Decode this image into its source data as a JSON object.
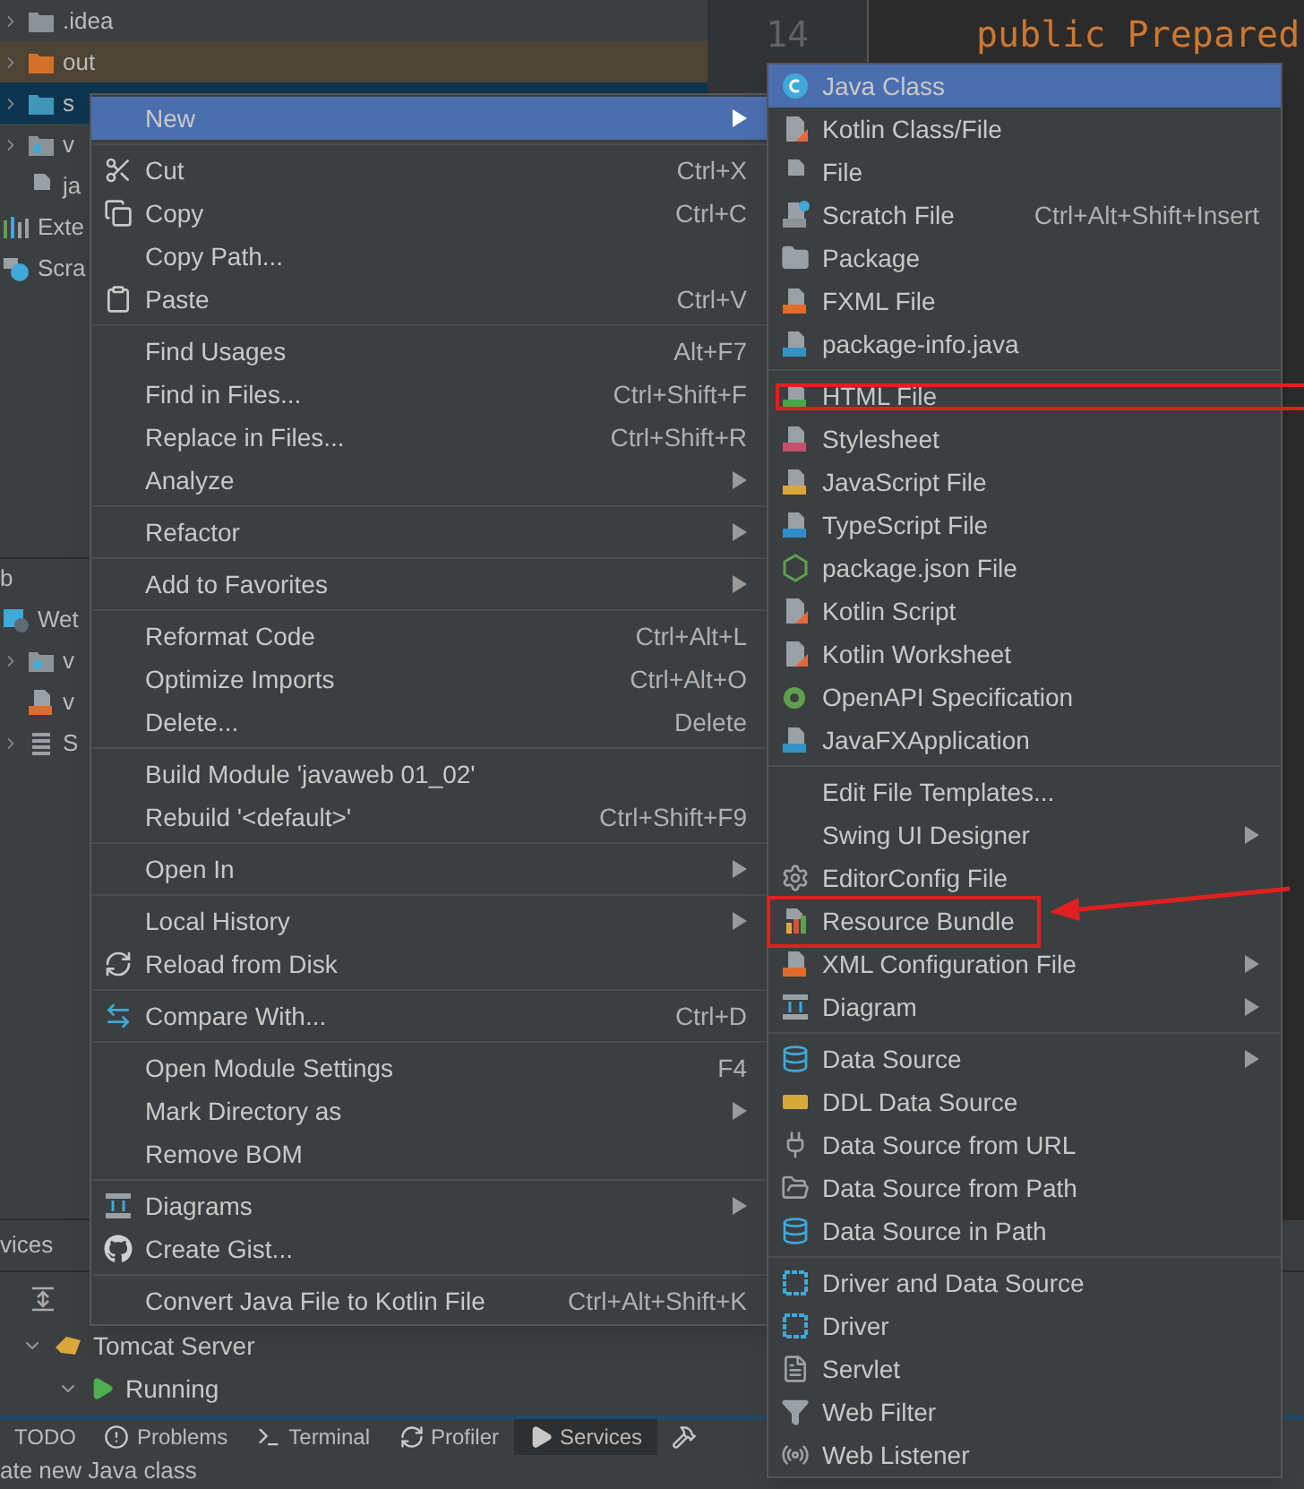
{
  "project_tree": [
    {
      "label": ".idea",
      "kind": "folder_gray",
      "selected": false,
      "highlighted": false,
      "expandable": true
    },
    {
      "label": "out",
      "kind": "folder_orange",
      "selected": false,
      "highlighted": true,
      "expandable": true
    },
    {
      "label": "s",
      "kind": "folder_blue",
      "selected": true,
      "highlighted": false,
      "expandable": true
    },
    {
      "label": "v",
      "kind": "folder_web",
      "selected": false,
      "highlighted": false,
      "expandable": true
    },
    {
      "label": "ja",
      "kind": "file",
      "selected": false,
      "highlighted": false,
      "expandable": false
    },
    {
      "label": "Exte",
      "kind": "libraries",
      "selected": false,
      "highlighted": false,
      "expandable": false
    },
    {
      "label": "Scra",
      "kind": "scratches",
      "selected": false,
      "highlighted": false,
      "expandable": false
    }
  ],
  "lower_panel_label": "b",
  "web_tree": [
    {
      "label": "Wet",
      "kind": "web",
      "selected": false,
      "highlighted": false,
      "expandable": false
    },
    {
      "label": "v",
      "kind": "folder_web",
      "selected": false,
      "highlighted": false,
      "expandable": true
    },
    {
      "label": "v",
      "kind": "war",
      "selected": false,
      "highlighted": false,
      "expandable": false
    },
    {
      "label": "S",
      "kind": "list",
      "selected": false,
      "highlighted": false,
      "expandable": true
    }
  ],
  "editor": {
    "line_numbers": [
      "14"
    ],
    "code": "public Prepared"
  },
  "context_menu": [
    {
      "label": "New",
      "submenu": true,
      "kind": "plain",
      "separator_before": false,
      "selected": true
    },
    {
      "label": "Cut",
      "shortcut": "Ctrl+X",
      "submenu": false,
      "kind": "cut",
      "separator_before": true,
      "selected": false
    },
    {
      "label": "Copy",
      "shortcut": "Ctrl+C",
      "submenu": false,
      "kind": "copy",
      "separator_before": false,
      "selected": false
    },
    {
      "label": "Copy Path...",
      "submenu": false,
      "kind": "plain",
      "separator_before": false,
      "selected": false
    },
    {
      "label": "Paste",
      "shortcut": "Ctrl+V",
      "submenu": false,
      "kind": "paste",
      "separator_before": false,
      "selected": false
    },
    {
      "label": "Find Usages",
      "shortcut": "Alt+F7",
      "submenu": false,
      "kind": "plain",
      "separator_before": true,
      "selected": false
    },
    {
      "label": "Find in Files...",
      "shortcut": "Ctrl+Shift+F",
      "submenu": false,
      "kind": "plain",
      "separator_before": false,
      "selected": false
    },
    {
      "label": "Replace in Files...",
      "shortcut": "Ctrl+Shift+R",
      "submenu": false,
      "kind": "plain",
      "separator_before": false,
      "selected": false
    },
    {
      "label": "Analyze",
      "submenu": true,
      "kind": "plain",
      "separator_before": false,
      "selected": false
    },
    {
      "label": "Refactor",
      "submenu": true,
      "kind": "plain",
      "separator_before": true,
      "selected": false
    },
    {
      "label": "Add to Favorites",
      "submenu": true,
      "kind": "plain",
      "separator_before": true,
      "selected": false
    },
    {
      "label": "Reformat Code",
      "shortcut": "Ctrl+Alt+L",
      "submenu": false,
      "kind": "plain",
      "separator_before": true,
      "selected": false
    },
    {
      "label": "Optimize Imports",
      "shortcut": "Ctrl+Alt+O",
      "submenu": false,
      "kind": "plain",
      "separator_before": false,
      "selected": false
    },
    {
      "label": "Delete...",
      "shortcut": "Delete",
      "submenu": false,
      "kind": "plain",
      "separator_before": false,
      "selected": false
    },
    {
      "label": "Build Module 'javaweb 01_02'",
      "submenu": false,
      "kind": "plain",
      "separator_before": true,
      "selected": false
    },
    {
      "label": "Rebuild '<default>'",
      "shortcut": "Ctrl+Shift+F9",
      "submenu": false,
      "kind": "plain",
      "separator_before": false,
      "selected": false
    },
    {
      "label": "Open In",
      "submenu": true,
      "kind": "plain",
      "separator_before": true,
      "selected": false
    },
    {
      "label": "Local History",
      "submenu": true,
      "kind": "plain",
      "separator_before": true,
      "selected": false
    },
    {
      "label": "Reload from Disk",
      "submenu": false,
      "kind": "reload",
      "separator_before": false,
      "selected": false
    },
    {
      "label": "Compare With...",
      "shortcut": "Ctrl+D",
      "submenu": false,
      "kind": "compare",
      "separator_before": true,
      "selected": false
    },
    {
      "label": "Open Module Settings",
      "shortcut": "F4",
      "submenu": false,
      "kind": "plain",
      "separator_before": true,
      "selected": false
    },
    {
      "label": "Mark Directory as",
      "submenu": true,
      "kind": "plain",
      "separator_before": false,
      "selected": false
    },
    {
      "label": "Remove BOM",
      "submenu": false,
      "kind": "plain",
      "separator_before": false,
      "selected": false
    },
    {
      "label": "Diagrams",
      "submenu": true,
      "kind": "diagram",
      "separator_before": true,
      "selected": false
    },
    {
      "label": "Create Gist...",
      "submenu": false,
      "kind": "github",
      "separator_before": false,
      "selected": false
    },
    {
      "label": "Convert Java File to Kotlin File",
      "shortcut": "Ctrl+Alt+Shift+K",
      "submenu": false,
      "kind": "plain",
      "separator_before": true,
      "selected": false
    }
  ],
  "new_submenu": [
    {
      "label": "Java Class",
      "submenu": false,
      "kind": "java_class",
      "separator_before": false,
      "selected": true,
      "annotated": false
    },
    {
      "label": "Kotlin Class/File",
      "submenu": false,
      "kind": "kotlin",
      "separator_before": false,
      "selected": false,
      "annotated": false
    },
    {
      "label": "File",
      "submenu": false,
      "kind": "file",
      "separator_before": false,
      "selected": false,
      "annotated": false
    },
    {
      "label": "Scratch File",
      "shortcut": "Ctrl+Alt+Shift+Insert",
      "submenu": false,
      "kind": "scratch",
      "separator_before": false,
      "selected": false,
      "annotated": false
    },
    {
      "label": "Package",
      "submenu": false,
      "kind": "package",
      "separator_before": false,
      "selected": false,
      "annotated": false
    },
    {
      "label": "FXML File",
      "submenu": false,
      "kind": "fxml",
      "separator_before": false,
      "selected": false,
      "annotated": false
    },
    {
      "label": "package-info.java",
      "submenu": false,
      "kind": "java_file",
      "separator_before": false,
      "selected": false,
      "annotated": false
    },
    {
      "label": "HTML File",
      "submenu": false,
      "kind": "html",
      "separator_before": true,
      "selected": false,
      "annotated": true
    },
    {
      "label": "Stylesheet",
      "submenu": false,
      "kind": "css",
      "separator_before": false,
      "selected": false,
      "annotated": false
    },
    {
      "label": "JavaScript File",
      "submenu": false,
      "kind": "js",
      "separator_before": false,
      "selected": false,
      "annotated": false
    },
    {
      "label": "TypeScript File",
      "submenu": false,
      "kind": "ts",
      "separator_before": false,
      "selected": false,
      "annotated": false
    },
    {
      "label": "package.json File",
      "submenu": false,
      "kind": "node",
      "separator_before": false,
      "selected": false,
      "annotated": false
    },
    {
      "label": "Kotlin Script",
      "submenu": false,
      "kind": "kotlin",
      "separator_before": false,
      "selected": false,
      "annotated": false
    },
    {
      "label": "Kotlin Worksheet",
      "submenu": false,
      "kind": "kotlin",
      "separator_before": false,
      "selected": false,
      "annotated": false
    },
    {
      "label": "OpenAPI Specification",
      "submenu": false,
      "kind": "openapi",
      "separator_before": false,
      "selected": false,
      "annotated": false
    },
    {
      "label": "JavaFXApplication",
      "submenu": false,
      "kind": "java_file",
      "separator_before": false,
      "selected": false,
      "annotated": false
    },
    {
      "label": "Edit File Templates...",
      "submenu": false,
      "kind": "plain",
      "separator_before": true,
      "selected": false,
      "annotated": false
    },
    {
      "label": "Swing UI Designer",
      "submenu": true,
      "kind": "plain",
      "separator_before": false,
      "selected": false,
      "annotated": false
    },
    {
      "label": "EditorConfig File",
      "submenu": false,
      "kind": "gear",
      "separator_before": false,
      "selected": false,
      "annotated": false
    },
    {
      "label": "Resource Bundle",
      "submenu": false,
      "kind": "bundle",
      "separator_before": false,
      "selected": false,
      "annotated": true
    },
    {
      "label": "XML Configuration File",
      "submenu": true,
      "kind": "fxml",
      "separator_before": false,
      "selected": false,
      "annotated": false
    },
    {
      "label": "Diagram",
      "submenu": true,
      "kind": "diagram",
      "separator_before": false,
      "selected": false,
      "annotated": false
    },
    {
      "label": "Data Source",
      "submenu": true,
      "kind": "db",
      "separator_before": true,
      "selected": false,
      "annotated": false
    },
    {
      "label": "DDL Data Source",
      "submenu": false,
      "kind": "ddl",
      "separator_before": false,
      "selected": false,
      "annotated": false
    },
    {
      "label": "Data Source from URL",
      "submenu": false,
      "kind": "url",
      "separator_before": false,
      "selected": false,
      "annotated": false
    },
    {
      "label": "Data Source from Path",
      "submenu": false,
      "kind": "folder",
      "separator_before": false,
      "selected": false,
      "annotated": false
    },
    {
      "label": "Data Source in Path",
      "submenu": false,
      "kind": "db",
      "separator_before": false,
      "selected": false,
      "annotated": false
    },
    {
      "label": "Driver and Data Source",
      "submenu": false,
      "kind": "driver",
      "separator_before": true,
      "selected": false,
      "annotated": false
    },
    {
      "label": "Driver",
      "submenu": false,
      "kind": "driver",
      "separator_before": false,
      "selected": false,
      "annotated": false
    },
    {
      "label": "Servlet",
      "submenu": false,
      "kind": "servlet",
      "separator_before": false,
      "selected": false,
      "annotated": false
    },
    {
      "label": "Web Filter",
      "submenu": false,
      "kind": "filter",
      "separator_before": false,
      "selected": false,
      "annotated": false
    },
    {
      "label": "Web Listener",
      "submenu": false,
      "kind": "listener",
      "separator_before": false,
      "selected": false,
      "annotated": false
    }
  ],
  "services": {
    "title": "vices",
    "tree": [
      {
        "label": "Tomcat Server",
        "kind": "tomcat",
        "expanded": true,
        "children": [
          {
            "label": "Running",
            "kind": "run",
            "expanded": true
          }
        ]
      }
    ]
  },
  "tool_tabs": [
    {
      "label": "TODO",
      "kind": "plain",
      "selected": false
    },
    {
      "label": "Problems",
      "kind": "problems",
      "selected": false
    },
    {
      "label": "Terminal",
      "kind": "terminal",
      "selected": false
    },
    {
      "label": "Profiler",
      "kind": "profiler",
      "selected": false
    },
    {
      "label": "Services",
      "kind": "services",
      "selected": true
    },
    {
      "kind": "build",
      "selected": false
    }
  ],
  "status_bar": "ate new Java class"
}
